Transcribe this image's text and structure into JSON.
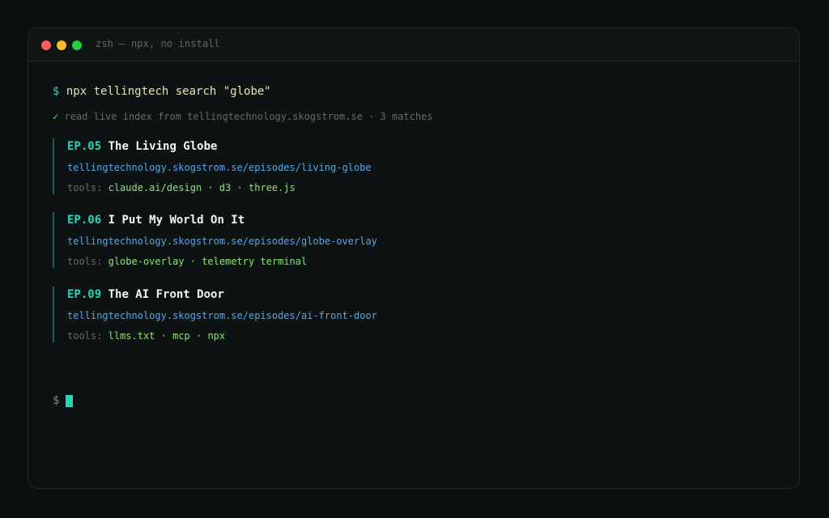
{
  "window": {
    "title": "zsh — npx, no install"
  },
  "command": {
    "prompt": "$",
    "text": "npx tellingtech search \"globe\""
  },
  "status": {
    "icon": "check-icon",
    "check": "✓",
    "text": "read live index from tellingtechnology.skogstrom.se · 3 matches"
  },
  "results": [
    {
      "id": "EP.05",
      "title": "The Living Globe",
      "url": "tellingtechnology.skogstrom.se/episodes/living-globe",
      "tools_label": "tools:",
      "tools": [
        "claude.ai/design",
        "d3",
        "three.js"
      ]
    },
    {
      "id": "EP.06",
      "title": "I Put My World On It",
      "url": "tellingtechnology.skogstrom.se/episodes/globe-overlay",
      "tools_label": "tools:",
      "tools": [
        "globe-overlay",
        "telemetry terminal"
      ]
    },
    {
      "id": "EP.09",
      "title": "The AI Front Door",
      "url": "tellingtechnology.skogstrom.se/episodes/ai-front-door",
      "tools_label": "tools:",
      "tools": [
        "llms.txt",
        "mcp",
        "npx"
      ]
    }
  ],
  "final_prompt": {
    "prompt": "$"
  },
  "colors": {
    "accent": "#2fd3b4",
    "link": "#58a6e8",
    "tool": "#8fe07a",
    "command": "#e7e4b5"
  }
}
